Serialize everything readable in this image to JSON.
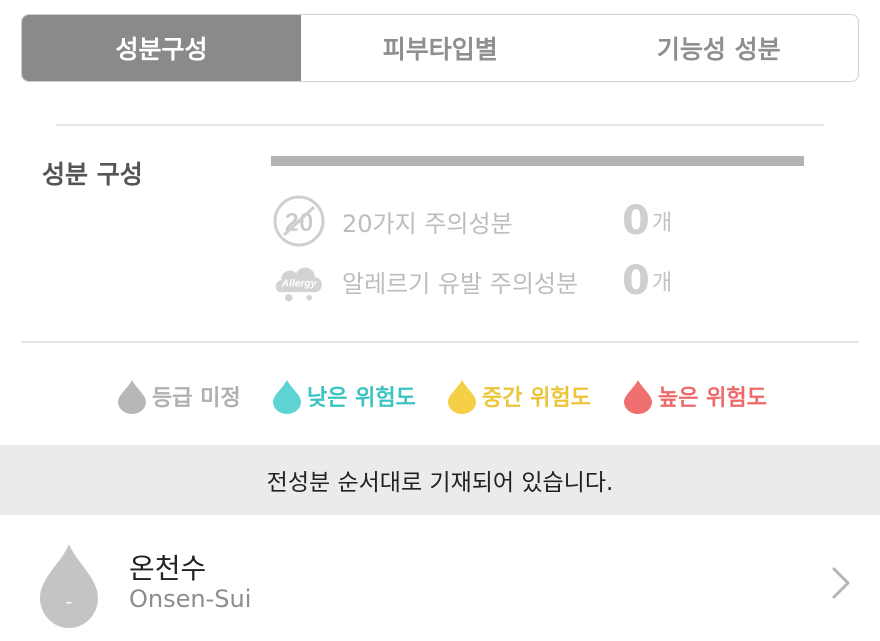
{
  "tabs": [
    {
      "label": "성분구성",
      "active": true
    },
    {
      "label": "피부타입별",
      "active": false
    },
    {
      "label": "기능성 성분",
      "active": false
    }
  ],
  "composition": {
    "title": "성분 구성",
    "stats": [
      {
        "icon": "twenty-badge-icon",
        "icon_text": "20",
        "label": "20가지 주의성분",
        "count": "0",
        "unit": "개"
      },
      {
        "icon": "allergy-cloud-icon",
        "icon_text": "Allergy",
        "label": "알레르기 유발 주의성분",
        "count": "0",
        "unit": "개"
      }
    ]
  },
  "legend": [
    {
      "label": "등급 미정",
      "color": "#b8b8b8",
      "text_color": "#b0b0b0"
    },
    {
      "label": "낮은 위험도",
      "color": "#5ed3d3",
      "text_color": "#3ec3c3"
    },
    {
      "label": "중간 위험도",
      "color": "#f5cf45",
      "text_color": "#ecc53a"
    },
    {
      "label": "높은 위험도",
      "color": "#f07070",
      "text_color": "#ee6a6a"
    }
  ],
  "notice": "전성분 순서대로 기재되어 있습니다.",
  "ingredients": [
    {
      "name": "온천수",
      "name_en": "Onsen-Sui",
      "grade": "-",
      "color": "#c4c4c4"
    }
  ]
}
